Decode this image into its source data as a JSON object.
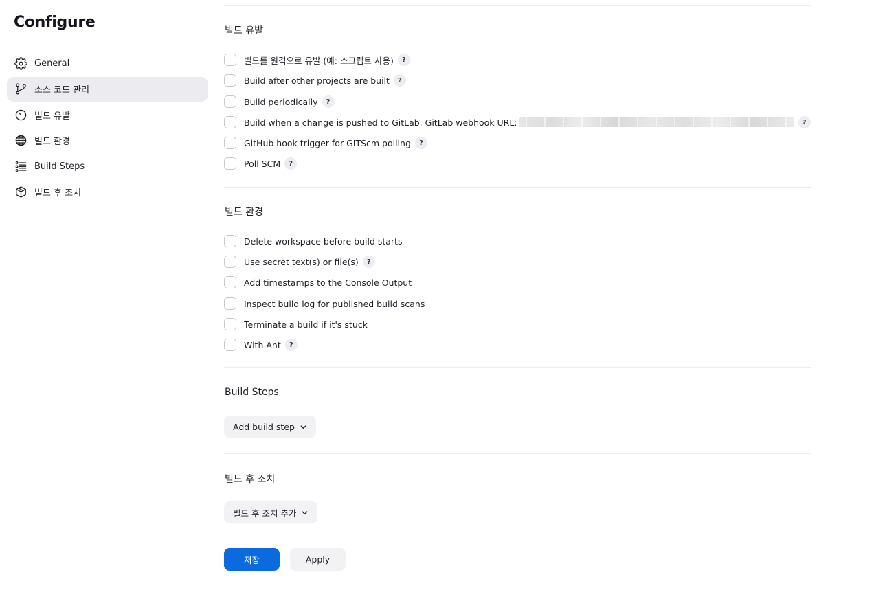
{
  "page_title": "Configure",
  "sidebar": {
    "items": [
      {
        "label": "General",
        "icon": "gear-icon"
      },
      {
        "label": "소스 코드 관리",
        "icon": "git-branch-icon",
        "active": true
      },
      {
        "label": "빌드 유발",
        "icon": "timer-icon"
      },
      {
        "label": "빌드 환경",
        "icon": "globe-icon"
      },
      {
        "label": "Build Steps",
        "icon": "list-icon"
      },
      {
        "label": "빌드 후 조치",
        "icon": "package-icon"
      }
    ]
  },
  "build_triggers": {
    "title": "빌드 유발",
    "options": [
      {
        "label": "빌드를 원격으로 유발 (예: 스크립트 사용)",
        "checked": false,
        "help": "?"
      },
      {
        "label": "Build after other projects are built",
        "checked": false,
        "help": "?"
      },
      {
        "label": "Build periodically",
        "checked": false,
        "help": "?"
      },
      {
        "label": "Build when a change is pushed to GitLab. GitLab webhook URL:",
        "checked": false,
        "help": "?"
      },
      {
        "label": "GitHub hook trigger for GITScm polling",
        "checked": false,
        "help": "?"
      },
      {
        "label": "Poll SCM",
        "checked": false,
        "help": "?"
      }
    ]
  },
  "build_environment": {
    "title": "빌드 환경",
    "options": [
      {
        "label": "Delete workspace before build starts",
        "checked": false
      },
      {
        "label": "Use secret text(s) or file(s)",
        "checked": false,
        "help": "?"
      },
      {
        "label": "Add timestamps to the Console Output",
        "checked": false
      },
      {
        "label": "Inspect build log for published build scans",
        "checked": false
      },
      {
        "label": "Terminate a build if it's stuck",
        "checked": false
      },
      {
        "label": "With Ant",
        "checked": false,
        "help": "?"
      }
    ]
  },
  "build_steps": {
    "title": "Build Steps",
    "add_button": "Add build step"
  },
  "post_build": {
    "title": "빌드 후 조치",
    "add_button": "빌드 후 조치 추가"
  },
  "actions": {
    "save": "저장",
    "apply": "Apply"
  },
  "colors": {
    "primary": "#0b6bde",
    "active_nav_bg": "#ececf0",
    "button_bg": "#f2f2f5"
  }
}
